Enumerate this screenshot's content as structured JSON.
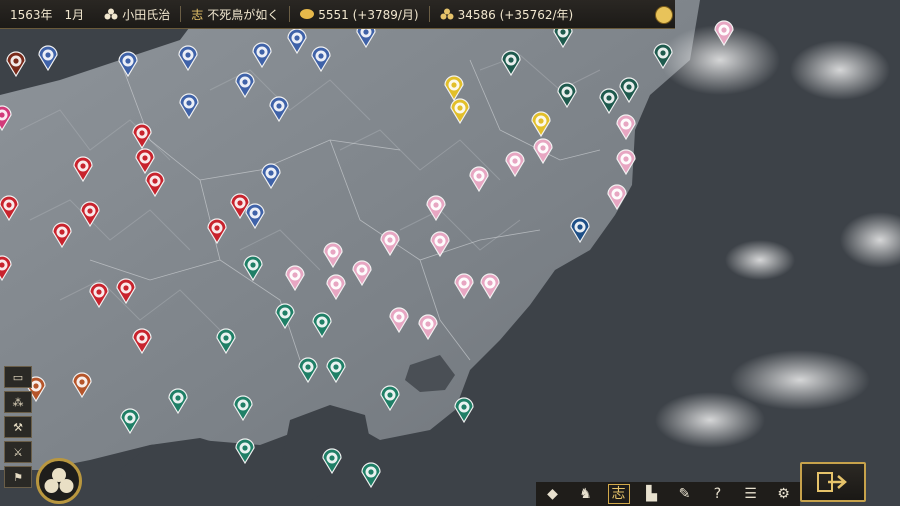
{
  "header": {
    "date": "1563年　1月",
    "player_clan": "小田氏治",
    "policy": "不死鳥が如く",
    "gold": "5551 (+3789/月)",
    "rice": "34586 (+35762/年)"
  },
  "icons": {
    "clan": "clan-crest-icon",
    "policy": "policy-icon",
    "gold": "gold-icon",
    "rice": "rice-icon",
    "menu": "menu-circle-icon"
  },
  "side_tools": [
    {
      "name": "gold-tool",
      "glyph": "▭"
    },
    {
      "name": "rice-tool",
      "glyph": "⁂"
    },
    {
      "name": "build-tool",
      "glyph": "⚒"
    },
    {
      "name": "army-tool",
      "glyph": "⚔"
    },
    {
      "name": "flag-tool",
      "glyph": "⚑"
    }
  ],
  "bottom_buttons": [
    {
      "name": "diamond-button",
      "glyph": "◆"
    },
    {
      "name": "horse-button",
      "glyph": "♞"
    },
    {
      "name": "policy-button",
      "glyph": "志",
      "active": true
    },
    {
      "name": "chart-button",
      "glyph": "▙"
    },
    {
      "name": "brush-button",
      "glyph": "✎"
    },
    {
      "name": "help-button",
      "glyph": "?"
    },
    {
      "name": "list-button",
      "glyph": "☰"
    },
    {
      "name": "settings-button",
      "glyph": "⚙"
    }
  ],
  "colors": {
    "red": "#c8232d",
    "pink": "#e7a6c2",
    "blue": "#3f62a8",
    "teal": "#1f7f66",
    "yellow": "#e2bf2a",
    "darkteal": "#1e5a4d",
    "magenta": "#d23a7a",
    "navy": "#1e4f86",
    "darkred": "#7a2a1a",
    "orange": "#b5552a"
  }
}
